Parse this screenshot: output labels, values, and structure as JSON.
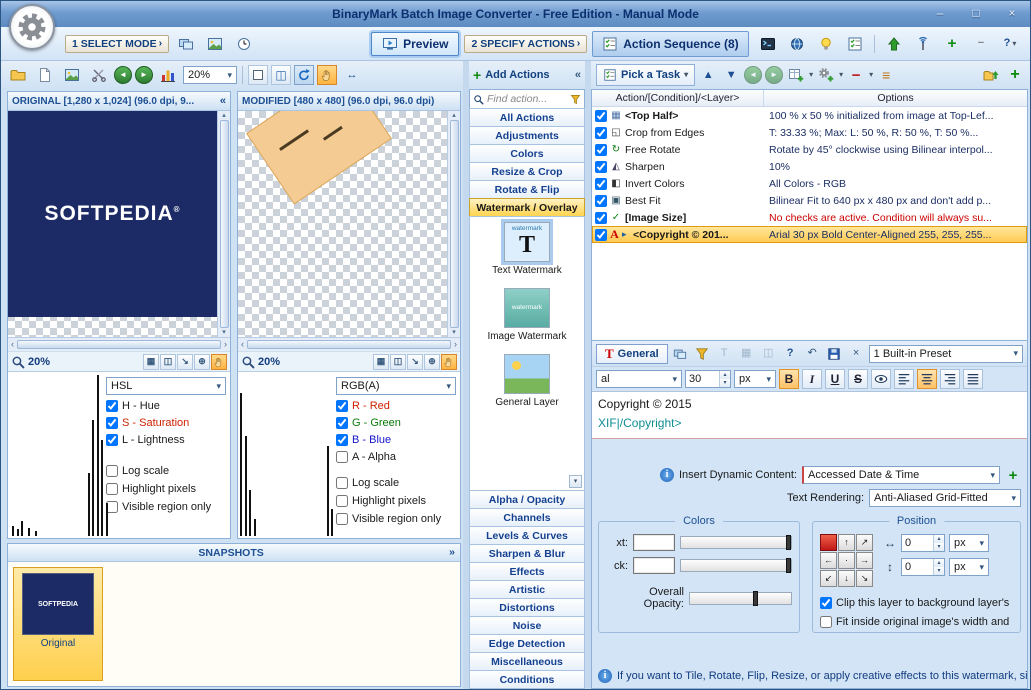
{
  "titlebar": {
    "title": "BinaryMark Batch Image Converter - Free Edition - Manual Mode"
  },
  "toolbar": {
    "select_mode": "1 SELECT MODE",
    "preview": "Preview",
    "specify_actions": "2 SPECIFY ACTIONS",
    "action_sequence": "Action Sequence (8)",
    "zoom": "20%",
    "pick_task": "Pick a Task"
  },
  "original": {
    "header": "ORIGINAL [1,280 x 1,024] (96.0 dpi, 9...",
    "image_text": "SOFTPEDIA",
    "zoom": "20%",
    "mode": "HSL",
    "channels": [
      {
        "label": "H - Hue",
        "checked": true,
        "color": "#1a1a1a"
      },
      {
        "label": "S - Saturation",
        "checked": true,
        "color": "#cc2200"
      },
      {
        "label": "L - Lightness",
        "checked": true,
        "color": "#1a1a1a"
      }
    ],
    "options": [
      {
        "label": "Log scale",
        "checked": false
      },
      {
        "label": "Highlight pixels",
        "checked": false
      },
      {
        "label": "Visible region only",
        "checked": false
      }
    ],
    "histogram": [
      [
        2,
        6
      ],
      [
        4,
        4
      ],
      [
        6,
        9
      ],
      [
        9,
        5
      ],
      [
        12,
        3
      ],
      [
        36,
        38
      ],
      [
        38,
        70
      ],
      [
        40,
        97
      ],
      [
        42,
        58
      ],
      [
        44,
        20
      ]
    ]
  },
  "modified": {
    "header": "MODIFIED [480 x 480] (96.0 dpi, 96.0 dpi)",
    "zoom": "20%",
    "mode": "RGB(A)",
    "channels": [
      {
        "label": "R - Red",
        "checked": true,
        "color": "#cc2200"
      },
      {
        "label": "G - Green",
        "checked": true,
        "color": "#0a7a0a"
      },
      {
        "label": "B - Blue",
        "checked": true,
        "color": "#1414cc"
      },
      {
        "label": "A - Alpha",
        "checked": false,
        "color": "#1a1a1a"
      }
    ],
    "options": [
      {
        "label": "Log scale",
        "checked": false
      },
      {
        "label": "Highlight pixels",
        "checked": false
      },
      {
        "label": "Visible region only",
        "checked": false
      }
    ],
    "histogram": [
      [
        1,
        86
      ],
      [
        3,
        60
      ],
      [
        5,
        28
      ],
      [
        7,
        10
      ],
      [
        40,
        54
      ],
      [
        42,
        16
      ]
    ]
  },
  "snapshots": {
    "header": "SNAPSHOTS",
    "items": [
      {
        "label": "Original",
        "image_text": "SOFTPEDIA"
      }
    ]
  },
  "add_actions": {
    "title": "Add Actions",
    "search_placeholder": "Find action...",
    "categories_top": [
      "All Actions",
      "Adjustments",
      "Colors",
      "Resize & Crop",
      "Rotate & Flip"
    ],
    "selected_category": "Watermark / Overlay",
    "items": [
      {
        "label": "Text Watermark",
        "kind": "text",
        "icon_text": "watermark",
        "selected": true
      },
      {
        "label": "Image Watermark",
        "kind": "image",
        "icon_text": "watermark",
        "selected": false
      },
      {
        "label": "General Layer",
        "kind": "layer",
        "icon_text": "",
        "selected": false
      }
    ],
    "categories_bottom": [
      "Alpha / Opacity",
      "Channels",
      "Levels & Curves",
      "Sharpen & Blur",
      "Effects",
      "Artistic",
      "Distortions",
      "Noise",
      "Edge Detection",
      "Miscellaneous",
      "Conditions"
    ]
  },
  "sequence": {
    "columns": [
      "Action/[Condition]/<Layer>",
      "Options"
    ],
    "rows": [
      {
        "checked": true,
        "icon": "layer",
        "name": "<Top Half>",
        "bold": true,
        "options": "100 % x 50 % initialized from image at Top-Lef...",
        "selected": false,
        "options_color": ""
      },
      {
        "checked": true,
        "icon": "crop",
        "name": "Crop from Edges",
        "bold": false,
        "options": "T: 33.33 %; Max: L: 50 %, R: 50 %, T: 50 %...",
        "selected": false,
        "options_color": ""
      },
      {
        "checked": true,
        "icon": "rotate",
        "name": "Free Rotate",
        "bold": false,
        "options": "Rotate by 45° clockwise using Bilinear interpol...",
        "selected": false,
        "options_color": ""
      },
      {
        "checked": true,
        "icon": "sharpen",
        "name": "Sharpen",
        "bold": false,
        "options": "10%",
        "selected": false,
        "options_color": ""
      },
      {
        "checked": true,
        "icon": "invert",
        "name": "Invert Colors",
        "bold": false,
        "options": "All Colors - RGB",
        "selected": false,
        "options_color": ""
      },
      {
        "checked": true,
        "icon": "fit",
        "name": "Best Fit",
        "bold": false,
        "options": "Bilinear Fit to 640 px x 480 px and don't add p...",
        "selected": false,
        "options_color": ""
      },
      {
        "checked": true,
        "icon": "condition",
        "name": "[Image Size]",
        "bold": true,
        "options": "No checks are active. Condition will always su...",
        "selected": false,
        "options_color": "#cc0000"
      },
      {
        "checked": true,
        "icon": "text",
        "name": "<Copyright © 201...",
        "bold": true,
        "options": "Arial 30 px Bold Center-Aligned 255, 255, 255...",
        "selected": true,
        "options_color": ""
      }
    ]
  },
  "editor": {
    "tab": "General",
    "preset": "1 Built-in Preset",
    "font_name": "al",
    "font_size": "30",
    "font_unit": "px",
    "format": {
      "bold": "B",
      "italic": "I",
      "underline": "U",
      "strike": "S"
    },
    "text_line1": "Copyright © 2015",
    "text_line2": "XIF|/Copyright>",
    "insert_label": "Insert Dynamic Content:",
    "insert_value": "Accessed Date & Time",
    "render_label": "Text Rendering:",
    "render_value": "Anti-Aliased Grid-Fitted"
  },
  "colors_group": {
    "title": "Colors",
    "text_label": "xt:",
    "back_label": "ck:",
    "opacity_label": "Overall Opacity:"
  },
  "position_group": {
    "title": "Position",
    "x_value": "0",
    "y_value": "0",
    "unit": "px",
    "clip_label": "Clip this layer to background layer's bou...",
    "clip_checked": true,
    "fit_label": "Fit inside original image's width and heigh...",
    "fit_checked": false
  },
  "hint": "If you want to Tile, Rotate, Flip, Resize, or apply creative effects to this watermark, simply"
}
